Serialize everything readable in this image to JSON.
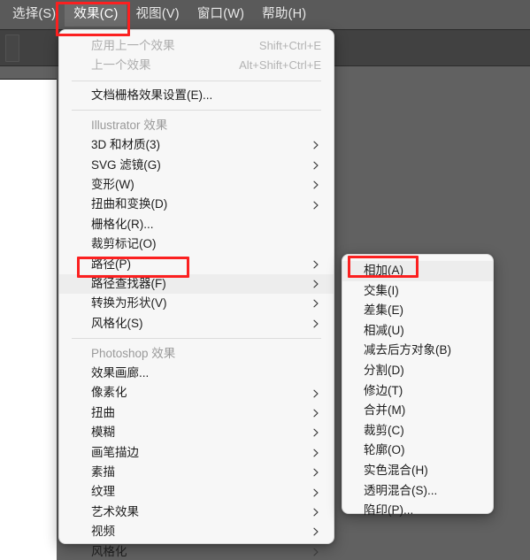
{
  "app": {
    "menubar": [
      {
        "label": "选择(S)",
        "active": false
      },
      {
        "label": "效果(C)",
        "active": true
      },
      {
        "label": "视图(V)",
        "active": false
      },
      {
        "label": "窗口(W)",
        "active": false
      },
      {
        "label": "帮助(H)",
        "active": false
      }
    ]
  },
  "effect_menu": {
    "items": [
      {
        "label": "应用上一个效果",
        "accel": "Shift+Ctrl+E",
        "disabled": true,
        "submenu": false,
        "separator_after": false
      },
      {
        "label": "上一个效果",
        "accel": "Alt+Shift+Ctrl+E",
        "disabled": true,
        "submenu": false,
        "separator_after": true
      },
      {
        "label": "文档栅格效果设置(E)...",
        "accel": "",
        "disabled": false,
        "submenu": false,
        "separator_after": true
      },
      {
        "label": "Illustrator 效果",
        "accel": "",
        "disabled": false,
        "submenu": false,
        "separator_after": false,
        "section": true
      },
      {
        "label": "3D 和材质(3)",
        "accel": "",
        "disabled": false,
        "submenu": true,
        "separator_after": false
      },
      {
        "label": "SVG 滤镜(G)",
        "accel": "",
        "disabled": false,
        "submenu": true,
        "separator_after": false
      },
      {
        "label": "变形(W)",
        "accel": "",
        "disabled": false,
        "submenu": true,
        "separator_after": false
      },
      {
        "label": "扭曲和变换(D)",
        "accel": "",
        "disabled": false,
        "submenu": true,
        "separator_after": false
      },
      {
        "label": "栅格化(R)...",
        "accel": "",
        "disabled": false,
        "submenu": false,
        "separator_after": false
      },
      {
        "label": "裁剪标记(O)",
        "accel": "",
        "disabled": false,
        "submenu": false,
        "separator_after": false
      },
      {
        "label": "路径(P)",
        "accel": "",
        "disabled": false,
        "submenu": true,
        "separator_after": false
      },
      {
        "label": "路径查找器(F)",
        "accel": "",
        "disabled": false,
        "submenu": true,
        "separator_after": false,
        "hovered": true
      },
      {
        "label": "转换为形状(V)",
        "accel": "",
        "disabled": false,
        "submenu": true,
        "separator_after": false
      },
      {
        "label": "风格化(S)",
        "accel": "",
        "disabled": false,
        "submenu": true,
        "separator_after": true
      },
      {
        "label": "Photoshop 效果",
        "accel": "",
        "disabled": false,
        "submenu": false,
        "separator_after": false,
        "section": true
      },
      {
        "label": "效果画廊...",
        "accel": "",
        "disabled": false,
        "submenu": false,
        "separator_after": false
      },
      {
        "label": "像素化",
        "accel": "",
        "disabled": false,
        "submenu": true,
        "separator_after": false
      },
      {
        "label": "扭曲",
        "accel": "",
        "disabled": false,
        "submenu": true,
        "separator_after": false
      },
      {
        "label": "模糊",
        "accel": "",
        "disabled": false,
        "submenu": true,
        "separator_after": false
      },
      {
        "label": "画笔描边",
        "accel": "",
        "disabled": false,
        "submenu": true,
        "separator_after": false
      },
      {
        "label": "素描",
        "accel": "",
        "disabled": false,
        "submenu": true,
        "separator_after": false
      },
      {
        "label": "纹理",
        "accel": "",
        "disabled": false,
        "submenu": true,
        "separator_after": false
      },
      {
        "label": "艺术效果",
        "accel": "",
        "disabled": false,
        "submenu": true,
        "separator_after": false
      },
      {
        "label": "视频",
        "accel": "",
        "disabled": false,
        "submenu": true,
        "separator_after": false
      },
      {
        "label": "风格化",
        "accel": "",
        "disabled": false,
        "submenu": true,
        "separator_after": false
      }
    ]
  },
  "pathfinder_submenu": {
    "items": [
      {
        "label": "相加(A)",
        "hovered": true
      },
      {
        "label": "交集(I)",
        "hovered": false
      },
      {
        "label": "差集(E)",
        "hovered": false
      },
      {
        "label": "相减(U)",
        "hovered": false
      },
      {
        "label": "减去后方对象(B)",
        "hovered": false
      },
      {
        "label": "分割(D)",
        "hovered": false
      },
      {
        "label": "修边(T)",
        "hovered": false
      },
      {
        "label": "合并(M)",
        "hovered": false
      },
      {
        "label": "裁剪(C)",
        "hovered": false
      },
      {
        "label": "轮廓(O)",
        "hovered": false
      },
      {
        "label": "实色混合(H)",
        "hovered": false
      },
      {
        "label": "透明混合(S)...",
        "hovered": false
      },
      {
        "label": "陷印(P)...",
        "hovered": false
      }
    ]
  },
  "annotations": {
    "color": "#fb2020",
    "boxes": [
      {
        "name": "menubar-effect-menu"
      },
      {
        "name": "pathfinder-menu-item"
      },
      {
        "name": "add-submenu-item"
      }
    ]
  },
  "colors": {
    "menubar_bg": "#5a5a5a",
    "menubar_active_bg": "#6d6d6d",
    "toolbar_bg": "#414141",
    "workspace_bg": "#616161",
    "menu_bg": "#f7f7f7",
    "menu_hover_bg": "#ededed",
    "menu_text": "#1d1d1d",
    "menu_disabled_text": "#adadad",
    "section_text": "#9a9a9a",
    "canvas_bg": "#ffffff"
  }
}
